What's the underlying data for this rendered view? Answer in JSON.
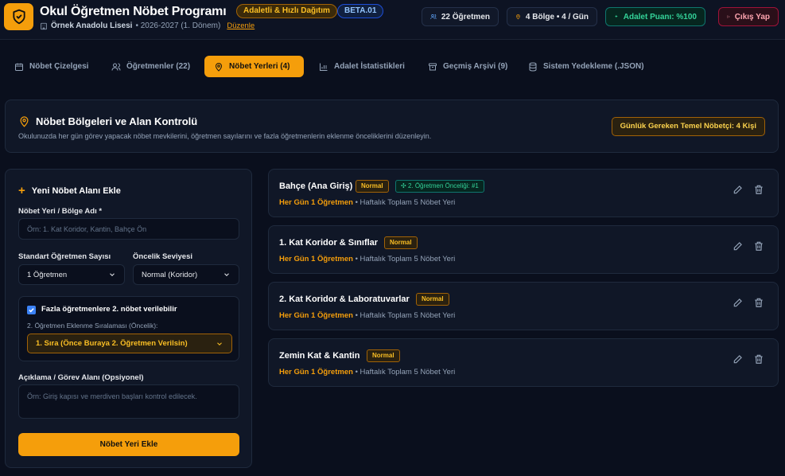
{
  "header": {
    "title": "Okul Öğretmen Nöbet Programı",
    "badge_fair": "Adaletli & Hızlı Dağıtım",
    "badge_beta": "BETA.01",
    "school_name": "Örnek Anadolu Lisesi",
    "term": "• 2026-2027 (1. Dönem)",
    "edit_link": "Düzenle",
    "teachers_stat": "22 Öğretmen",
    "regions_stat": "4 Bölge • 4 / Gün",
    "fair_score": "Adalet Puanı: %100",
    "logout": "Çıkış Yap"
  },
  "tabs": [
    {
      "label": "Nöbet Çizelgesi",
      "icon": "calendar-icon"
    },
    {
      "label": "Öğretmenler (22)",
      "icon": "users-icon"
    },
    {
      "label": "Nöbet Yerleri (4)",
      "icon": "map-pin-icon",
      "active": true
    },
    {
      "label": "Adalet İstatistikleri",
      "icon": "bar-chart-icon"
    },
    {
      "label": "Geçmiş Arşivi (9)",
      "icon": "archive-icon"
    },
    {
      "label": "Sistem Yedekleme (.JSON)",
      "icon": "database-icon"
    }
  ],
  "info": {
    "title": "Nöbet Bölgeleri ve Alan Kontrolü",
    "description": "Okulunuzda her gün görev yapacak nöbet mevkilerini, öğretmen sayılarını ve fazla öğretmenlerin eklenme önceliklerini düzenleyin.",
    "daily_required": "Günlük Gereken Temel Nöbetçi: 4 Kişi"
  },
  "form": {
    "title": "Yeni Nöbet Alanı Ekle",
    "name_label": "Nöbet Yeri / Bölge Adı *",
    "name_placeholder": "Örn: 1. Kat Koridor, Kantin, Bahçe Ön",
    "count_label": "Standart Öğretmen Sayısı",
    "count_value": "1 Öğretmen",
    "priority_label": "Öncelik Seviyesi",
    "priority_value": "Normal (Koridor)",
    "second_checkbox_label": "Fazla öğretmenlere 2. nöbet verilebilir",
    "second_checked": true,
    "order_label": "2. Öğretmen Eklenme Sıralaması (Öncelik):",
    "order_value": "1. Sıra (Önce Buraya 2. Öğretmen Verilsin)",
    "desc_label": "Açıklama / Görev Alanı (Opsiyonel)",
    "desc_placeholder": "Örn: Giriş kapısı ve merdiven başları kontrol edilecek.",
    "submit": "Nöbet Yeri Ekle"
  },
  "locations": [
    {
      "name": "Bahçe (Ana Giriş)",
      "priority": "Normal",
      "second": "2. Öğretmen Önceliği: #1",
      "daily": "Her Gün 1 Öğretmen",
      "weekly": "• Haftalık Toplam 5 Nöbet Yeri"
    },
    {
      "name": "1. Kat Koridor & Sınıflar",
      "priority": "Normal",
      "second": "",
      "daily": "Her Gün 1 Öğretmen",
      "weekly": "• Haftalık Toplam 5 Nöbet Yeri"
    },
    {
      "name": "2. Kat Koridor & Laboratuvarlar",
      "priority": "Normal",
      "second": "",
      "daily": "Her Gün 1 Öğretmen",
      "weekly": "• Haftalık Toplam 5 Nöbet Yeri"
    },
    {
      "name": "Zemin Kat & Kantin",
      "priority": "Normal",
      "second": "",
      "daily": "Her Gün 1 Öğretmen",
      "weekly": "• Haftalık Toplam 5 Nöbet Yeri"
    }
  ],
  "colors": {
    "accent": "#f59e0b",
    "background": "#0a0f1d",
    "success": "#34d399",
    "danger": "#fda4af"
  }
}
